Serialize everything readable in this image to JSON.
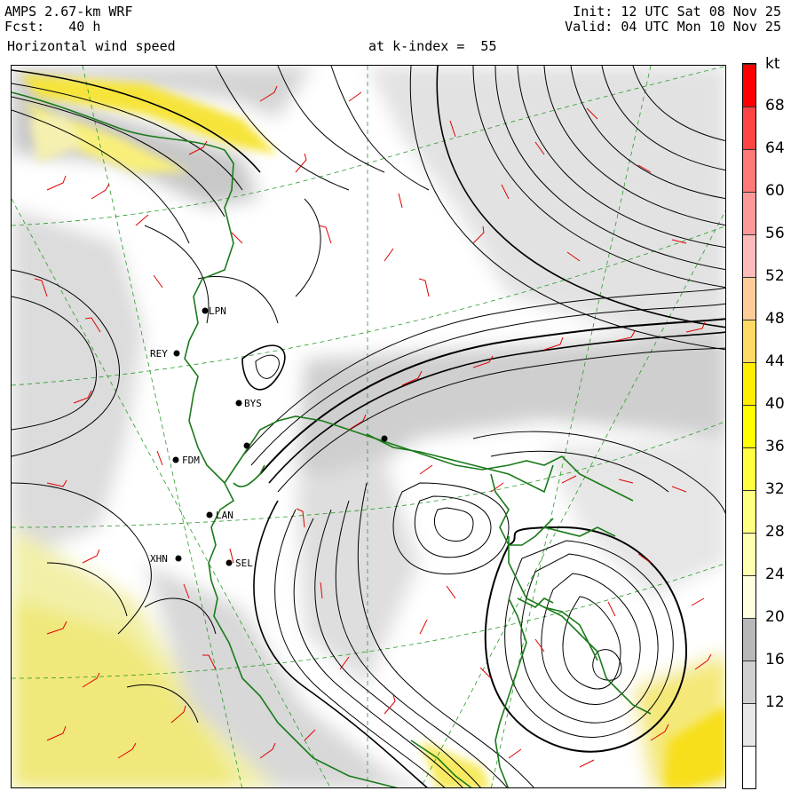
{
  "header": {
    "model": "AMPS 2.67-km WRF",
    "forecast": "Fcst:   40 h",
    "variable": "Horizontal wind speed",
    "level": "at k-index =  55",
    "init": "Init: 12 UTC Sat 08 Nov 25",
    "valid": "Valid: 04 UTC Mon 10 Nov 25"
  },
  "colorbar": {
    "unit": "kt",
    "tick_labels": [
      "12",
      "16",
      "20",
      "24",
      "28",
      "32",
      "36",
      "40",
      "44",
      "48",
      "52",
      "56",
      "60",
      "64",
      "68"
    ],
    "colors": [
      "#ffffff",
      "#e8e8e8",
      "#d0d0d0",
      "#b8b8b8",
      "#ffffe0",
      "#ffffb0",
      "#ffff80",
      "#ffff40",
      "#ffff00",
      "#ffee00",
      "#ffd966",
      "#ffcc99",
      "#ffbbbb",
      "#ff9999",
      "#ff7777",
      "#ff4444",
      "#ff0000"
    ]
  },
  "stations": [
    {
      "code": "REY"
    },
    {
      "code": "BYS"
    },
    {
      "code": "FDM"
    },
    {
      "code": "LAN"
    },
    {
      "code": "XHN"
    },
    {
      "code": "SEL"
    },
    {
      "code": "LPN"
    }
  ],
  "map_colors": {
    "coast": "#1a7a1a",
    "barb": "#e00000",
    "grid": "#2a9a2a",
    "contour": "#000000"
  }
}
